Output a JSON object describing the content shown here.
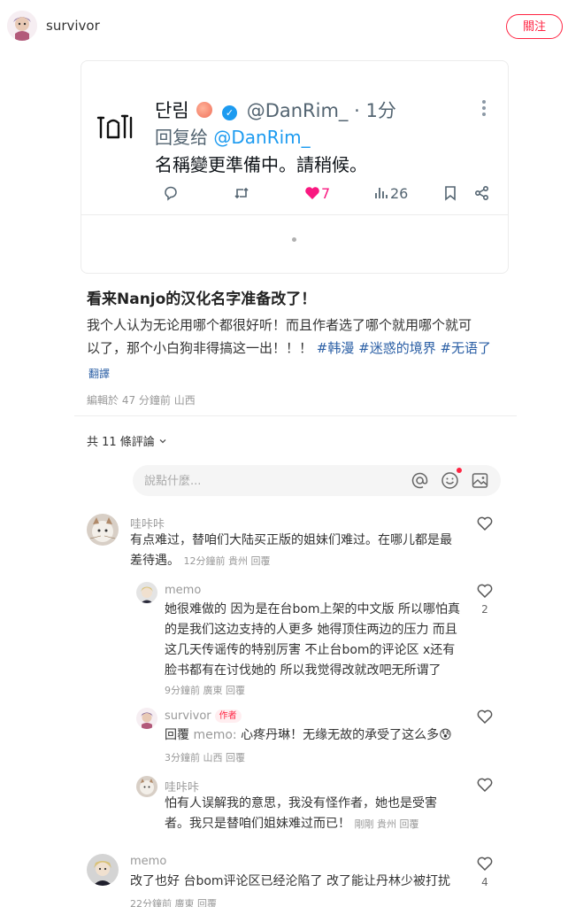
{
  "header": {
    "username": "survivor",
    "follow_label": "關注"
  },
  "tweet": {
    "display_name": "단림",
    "handle_time": "@DanRim_ · 1分",
    "reply_prefix": "回复给",
    "reply_mention": "@DanRim_",
    "text": "名稱變更準備中。請稍候。",
    "likes": "7",
    "views": "26"
  },
  "post": {
    "title": "看来Nanjo的汉化名字准备改了！",
    "body_line1": "我个人认为无论用哪个都很好听！而且作者选了哪个就用哪个就可",
    "body_line2": "以了，那个小白狗非得搞这一出！！！",
    "tags": "#韩漫 #迷惑的境界 #无语了",
    "translate_label": "翻譯",
    "meta": "編輯於 47 分鐘前 山西"
  },
  "comments_header": {
    "count_label": "共 11 條評論"
  },
  "input": {
    "placeholder": "說點什麼..."
  },
  "comments": [
    {
      "name": "哇咔咔",
      "text_line1": "有点难过，替咱们大陆买正版的姐妹们难过。在哪儿都是最",
      "text_line2": "差待遇。",
      "meta": "12分鐘前 貴州 回覆",
      "likes": ""
    },
    {
      "name": "memo",
      "text": "她很难做的 因为是在台bom上架的中文版 所以哪怕真的是我们这边支持的人更多 她得顶住两边的压力 而且这几天传谣传的特别厉害 不止台bom的评论区 x还有脸书都有在讨伐她的 所以我觉得改就改吧无所谓了",
      "meta": "9分鐘前 廣東 回覆",
      "likes": "2"
    },
    {
      "name": "survivor",
      "badge": "作者",
      "reply_prefix": "回覆",
      "reply_ref": "memo:",
      "text": "心疼丹琳！无缘无故的承受了这么多😰",
      "meta": "3分鐘前 山西 回覆",
      "likes": ""
    },
    {
      "name": "哇咔咔",
      "text_line1": "怕有人误解我的意思，我没有怪作者，她也是受害",
      "text_line2": "者。我只是替咱们姐妹难过而已！",
      "meta": "剛剛 貴州 回覆",
      "likes": ""
    },
    {
      "name": "memo",
      "text": "改了也好 台bom评论区已经沦陷了 改了能让丹林少被打扰",
      "meta": "22分鐘前 廣東 回覆",
      "likes": "4"
    }
  ],
  "colors": {
    "accent": "#ff2442",
    "link": "#2b5fa5",
    "twitter_blue": "#1d9bf0",
    "heart_pink": "#f91880"
  }
}
